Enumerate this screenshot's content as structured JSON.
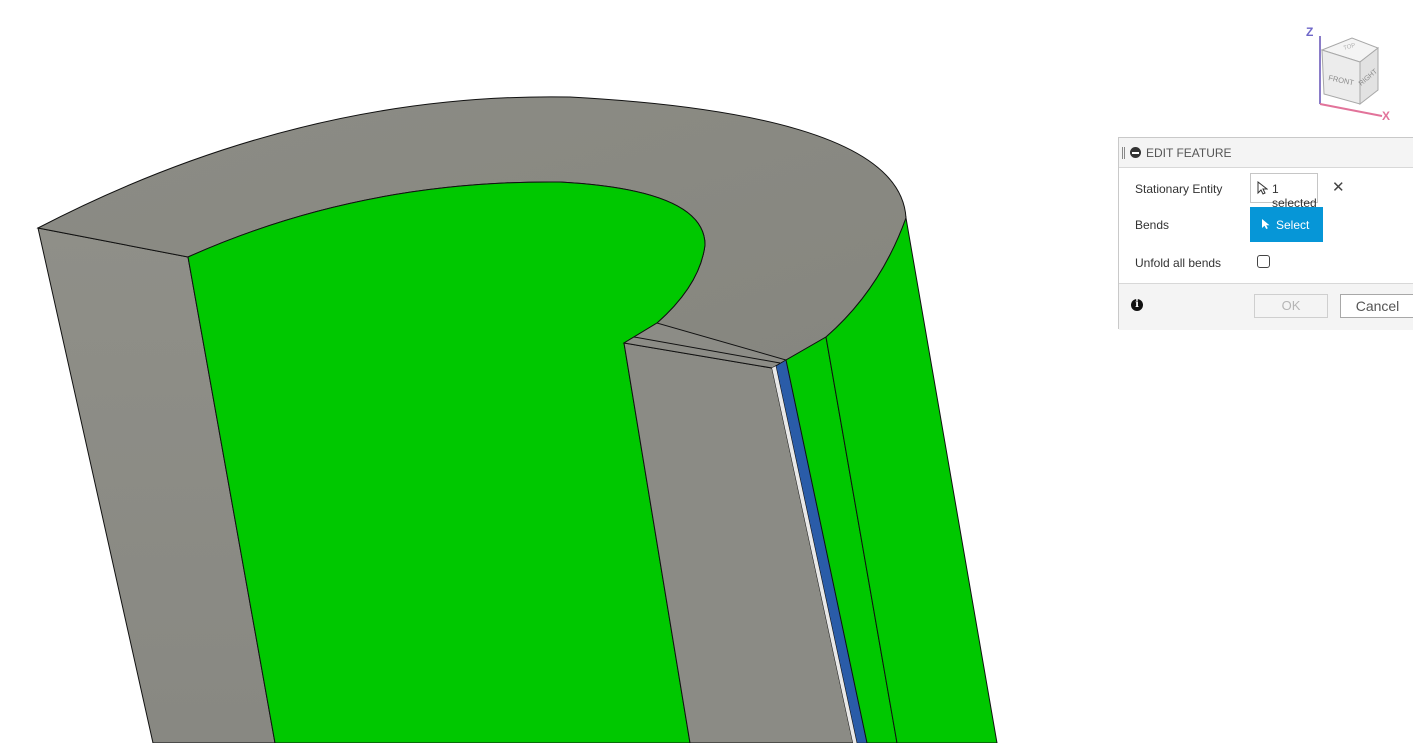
{
  "viewcube": {
    "axis_z": "Z",
    "axis_x": "X",
    "face_front": "FRONT",
    "face_right": "RIGHT",
    "face_top": "TOP"
  },
  "panel": {
    "title": "EDIT FEATURE",
    "stationary_entity": {
      "label": "Stationary Entity",
      "value": "1 selected"
    },
    "bends": {
      "label": "Bends",
      "button": "Select"
    },
    "unfold_all_bends": {
      "label": "Unfold all bends",
      "checked": false
    },
    "ok_label": "OK",
    "cancel_label": "Cancel"
  },
  "colors": {
    "model_gray": "#8a8a83",
    "selected_green": "#00c800",
    "bend_blue": "#2a5ca8",
    "accent_blue": "#0696d7"
  }
}
